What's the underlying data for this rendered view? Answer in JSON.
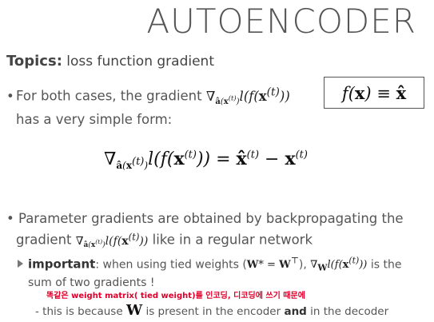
{
  "slide": {
    "title": "AUTOENCODER",
    "topics_label": "Topics:",
    "topics_text": "loss function gradient",
    "bullet1_line1": "For both cases, the gradient",
    "bullet1_line2": "has a very simple form:",
    "box_formula": "f(x) ≡ x̂",
    "bullet2_line1": "Parameter gradients are obtained by backpropagating the",
    "bullet2_prefix": "gradient",
    "bullet2_suffix": "like in a regular network",
    "sub1_label": "important",
    "sub1_text_a": ": when using tied weights (",
    "sub1_text_b": "), ",
    "sub1_text_c": " is the",
    "sub1_line2": "sum of two gradients !",
    "korean_note": "똑같은 weight matrix( tied weight)를 인코딩, 디코딩에 쓰기 때문에",
    "sub2_prefix": "- this is because",
    "sub2_W": "W",
    "sub2_mid": "is present in the encoder",
    "sub2_and": "and",
    "sub2_end": "in the decoder"
  }
}
